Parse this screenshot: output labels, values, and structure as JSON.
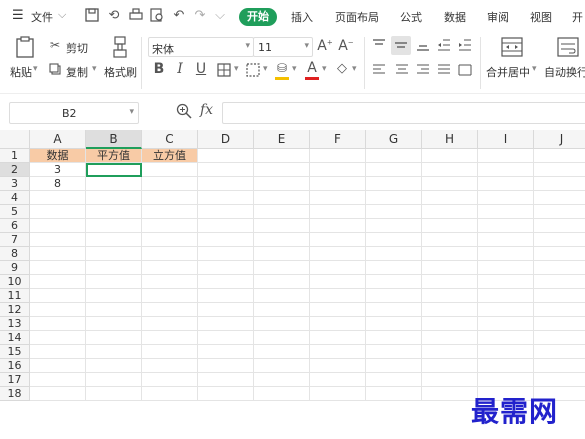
{
  "menu": {
    "file_label": "文件",
    "tabs": [
      "开始",
      "插入",
      "页面布局",
      "公式",
      "数据",
      "审阅",
      "视图",
      "开"
    ]
  },
  "ribbon": {
    "paste_label": "粘贴",
    "cut_label": "剪切",
    "copy_label": "复制",
    "format_painter_label": "格式刷",
    "font_name": "宋体",
    "font_size": "11",
    "merge_center_label": "合并居中",
    "auto_wrap_label": "自动换行",
    "font_color": "#e02020",
    "fill_color": "#f5c000"
  },
  "formula_bar": {
    "name_box": "B2",
    "fx_label": "fx",
    "value": ""
  },
  "sheet": {
    "columns": [
      "A",
      "B",
      "C",
      "D",
      "E",
      "F",
      "G",
      "H",
      "I",
      "J"
    ],
    "rows": [
      "1",
      "2",
      "3",
      "4",
      "5",
      "6",
      "7",
      "8",
      "9",
      "10",
      "11",
      "12",
      "13",
      "14",
      "15",
      "16",
      "17",
      "18"
    ],
    "selected_cell": "B2",
    "cells": {
      "A1": "数据",
      "B1": "平方值",
      "C1": "立方值",
      "A2": "3",
      "A3": "8"
    },
    "header_fill": "#f8cba6",
    "accent": "#1f9e5b"
  },
  "watermark": "最需网"
}
